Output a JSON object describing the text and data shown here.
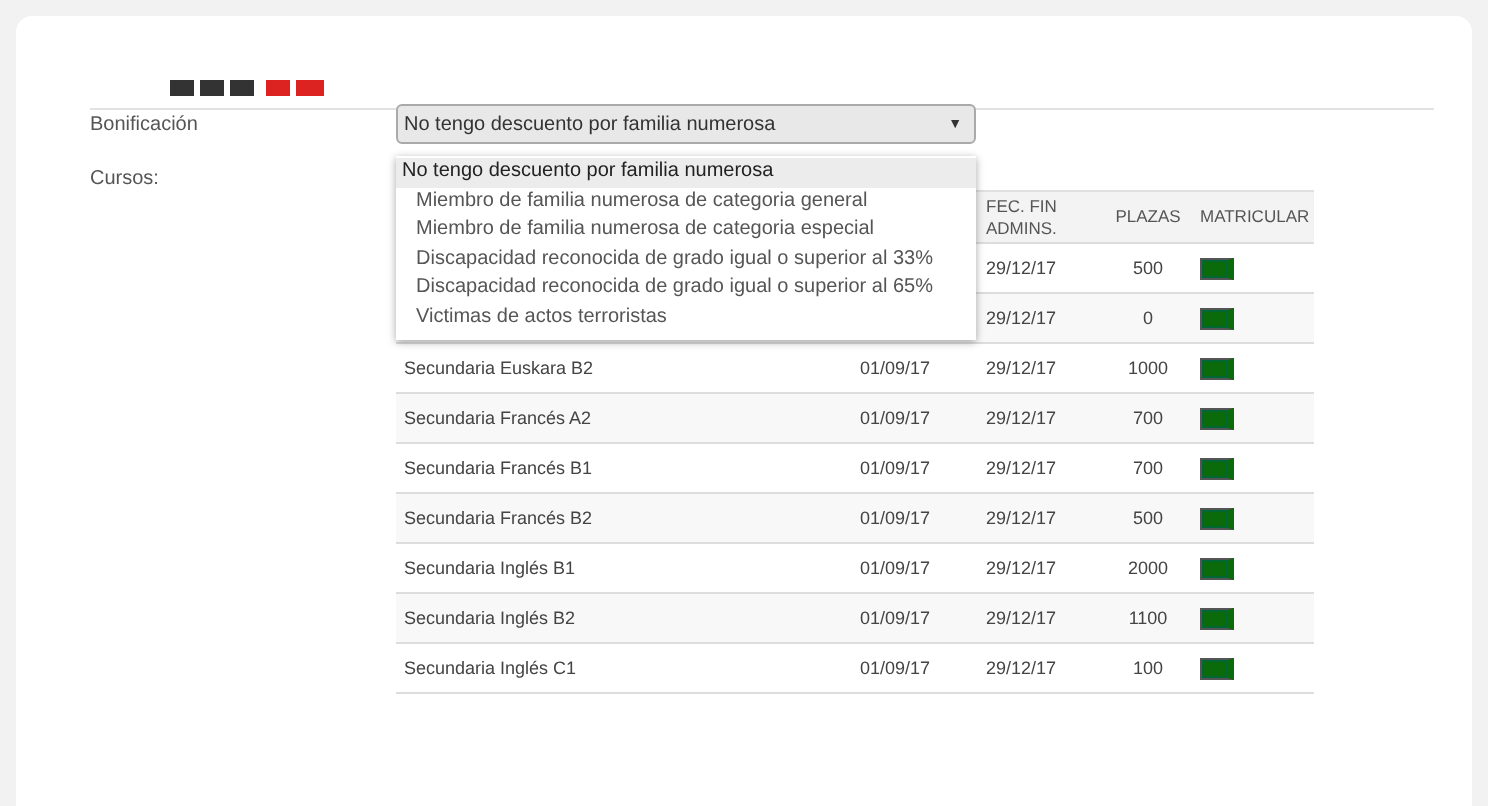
{
  "form": {
    "bonificacion": {
      "label": "Bonificación",
      "value": "No tengo descuento por familia numerosa",
      "caret": "▼",
      "options": [
        {
          "label": "No tengo descuento por familia numerosa",
          "selected": true
        },
        {
          "label": "Miembro de familia numerosa de categoria general",
          "selected": false
        },
        {
          "label": "Miembro de familia numerosa de categoria especial",
          "selected": false
        },
        {
          "label": "Discapacidad reconocida de grado igual o superior al 33%",
          "selected": false
        },
        {
          "label": "Discapacidad reconocida de grado igual o superior al 65%",
          "selected": false
        },
        {
          "label": "Victimas de actos terroristas",
          "selected": false
        }
      ]
    },
    "cursos_label": "Cursos:"
  },
  "table": {
    "columns": [
      {},
      {},
      {
        "label": "FEC. FIN ADMINS."
      },
      {
        "label": "PLAZAS"
      },
      {
        "label": "MATRICULAR"
      }
    ],
    "rows": [
      {
        "end": "29/12/17",
        "plazas": "500"
      },
      {
        "end": "29/12/17",
        "plazas": "0"
      },
      {
        "course": "Secundaria Euskara B2",
        "start": "01/09/17",
        "end": "29/12/17",
        "plazas": "1000"
      },
      {
        "course": "Secundaria Francés A2",
        "start": "01/09/17",
        "end": "29/12/17",
        "plazas": "700"
      },
      {
        "course": "Secundaria Francés B1",
        "start": "01/09/17",
        "end": "29/12/17",
        "plazas": "700"
      },
      {
        "course": "Secundaria Francés B2",
        "start": "01/09/17",
        "end": "29/12/17",
        "plazas": "500"
      },
      {
        "course": "Secundaria Inglés B1",
        "start": "01/09/17",
        "end": "29/12/17",
        "plazas": "2000"
      },
      {
        "course": "Secundaria Inglés B2",
        "start": "01/09/17",
        "end": "29/12/17",
        "plazas": "1100"
      },
      {
        "course": "Secundaria Inglés C1",
        "start": "01/09/17",
        "end": "29/12/17",
        "plazas": "100"
      }
    ]
  }
}
